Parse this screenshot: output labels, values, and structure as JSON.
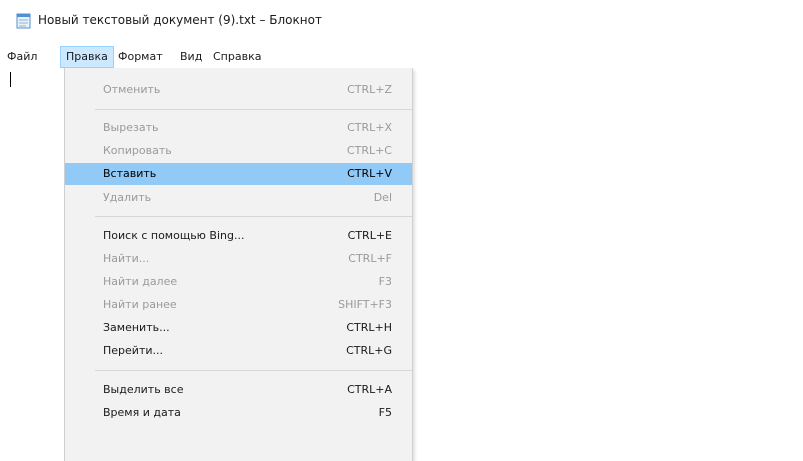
{
  "window": {
    "title": "Новый текстовый документ (9).txt – Блокнот"
  },
  "menubar": {
    "items": [
      {
        "label": "Файл"
      },
      {
        "label": "Правка"
      },
      {
        "label": "Формат"
      },
      {
        "label": "Вид"
      },
      {
        "label": "Справка"
      }
    ]
  },
  "edit_menu": {
    "items": [
      {
        "label": "Отменить",
        "shortcut": "CTRL+Z",
        "state": "disabled"
      },
      {
        "label": "Вырезать",
        "shortcut": "CTRL+X",
        "state": "disabled"
      },
      {
        "label": "Копировать",
        "shortcut": "CTRL+C",
        "state": "disabled"
      },
      {
        "label": "Вставить",
        "shortcut": "CTRL+V",
        "state": "highlighted"
      },
      {
        "label": "Удалить",
        "shortcut": "Del",
        "state": "disabled"
      },
      {
        "label": "Поиск с помощью Bing...",
        "shortcut": "CTRL+E",
        "state": "enabled"
      },
      {
        "label": "Найти...",
        "shortcut": "CTRL+F",
        "state": "disabled"
      },
      {
        "label": "Найти далее",
        "shortcut": "F3",
        "state": "disabled"
      },
      {
        "label": "Найти ранее",
        "shortcut": "SHIFT+F3",
        "state": "disabled"
      },
      {
        "label": "Заменить...",
        "shortcut": "CTRL+H",
        "state": "enabled"
      },
      {
        "label": "Перейти...",
        "shortcut": "CTRL+G",
        "state": "enabled"
      },
      {
        "label": "Выделить все",
        "shortcut": "CTRL+A",
        "state": "enabled"
      },
      {
        "label": "Время и дата",
        "shortcut": "F5",
        "state": "enabled"
      }
    ]
  },
  "icons": {
    "app": "notepad-icon"
  },
  "colors": {
    "highlight": "#91c9f7",
    "menu_active_bg": "#cce8ff",
    "menu_bg": "#f2f2f2",
    "disabled_text": "#9a9a9a"
  }
}
